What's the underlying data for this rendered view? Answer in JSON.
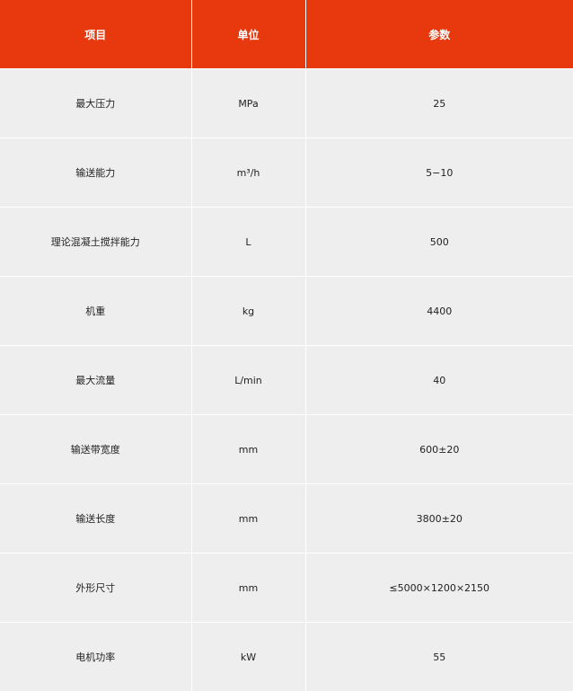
{
  "header": {
    "col1": "项目",
    "col2": "单位",
    "col3": "参数"
  },
  "accent_color": "#e8380d",
  "rows": [
    {
      "item": "最大压力",
      "unit": "MPa",
      "value": "25"
    },
    {
      "item": "输送能力",
      "unit": "m³/h",
      "value": "5−10"
    },
    {
      "item": "理论混凝土搅拌能力",
      "unit": "L",
      "value": "500"
    },
    {
      "item": "机重",
      "unit": "kg",
      "value": "4400"
    },
    {
      "item": "最大流量",
      "unit": "L/min",
      "value": "40"
    },
    {
      "item": "输送带宽度",
      "unit": "mm",
      "value": "600±20"
    },
    {
      "item": "输送长度",
      "unit": "mm",
      "value": "3800±20"
    },
    {
      "item": "外形尺寸",
      "unit": "mm",
      "value": "≤5000×1200×2150"
    },
    {
      "item": "电机功率",
      "unit": "kW",
      "value": "55"
    }
  ]
}
